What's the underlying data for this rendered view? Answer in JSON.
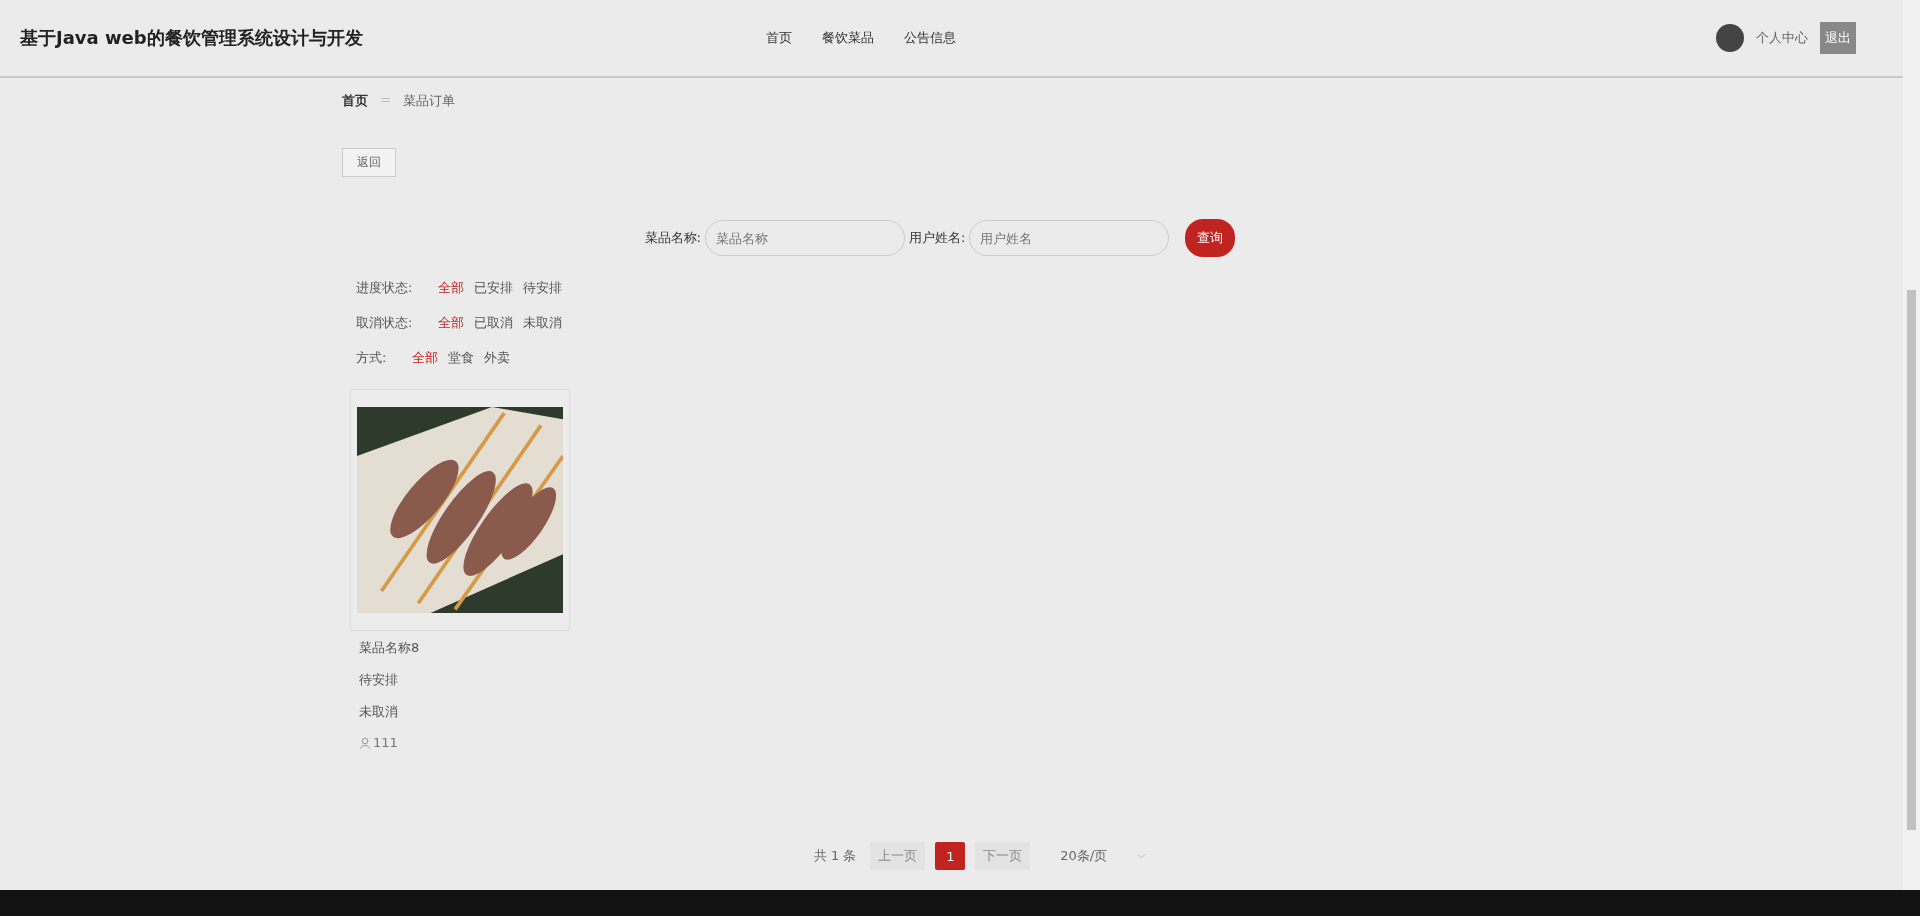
{
  "header": {
    "title": "基于Java web的餐饮管理系统设计与开发",
    "nav": [
      {
        "label": "首页"
      },
      {
        "label": "餐饮菜品"
      },
      {
        "label": "公告信息"
      }
    ],
    "user": {
      "center": "个人中心",
      "logout": "退出"
    }
  },
  "breadcrumb": {
    "home": "首页",
    "separator": "=",
    "current": "菜品订单"
  },
  "back_button": "返回",
  "search": {
    "fields": [
      {
        "label": "菜品名称:",
        "placeholder": "菜品名称"
      },
      {
        "label": "用户姓名:",
        "placeholder": "用户姓名"
      }
    ],
    "button": "查询"
  },
  "filters": [
    {
      "label": "进度状态:",
      "options": [
        {
          "label": "全部",
          "selected": true
        },
        {
          "label": "已安排",
          "selected": false
        },
        {
          "label": "待安排",
          "selected": false
        }
      ]
    },
    {
      "label": "取消状态:",
      "options": [
        {
          "label": "全部",
          "selected": true
        },
        {
          "label": "已取消",
          "selected": false
        },
        {
          "label": "未取消",
          "selected": false
        }
      ]
    },
    {
      "label": "方式:",
      "options": [
        {
          "label": "全部",
          "selected": true
        },
        {
          "label": "堂食",
          "selected": false
        },
        {
          "label": "外卖",
          "selected": false
        }
      ]
    }
  ],
  "orders": [
    {
      "name": "菜品名称8",
      "progress": "待安排",
      "cancel": "未取消",
      "user": "111"
    }
  ],
  "pagination": {
    "total": "共 1 条",
    "prev": {
      "label": "上一页",
      "disabled": true
    },
    "pages": [
      {
        "label": "1",
        "selected": true
      }
    ],
    "next": {
      "label": "下一页",
      "disabled": true
    },
    "page_size": "20条/页"
  }
}
